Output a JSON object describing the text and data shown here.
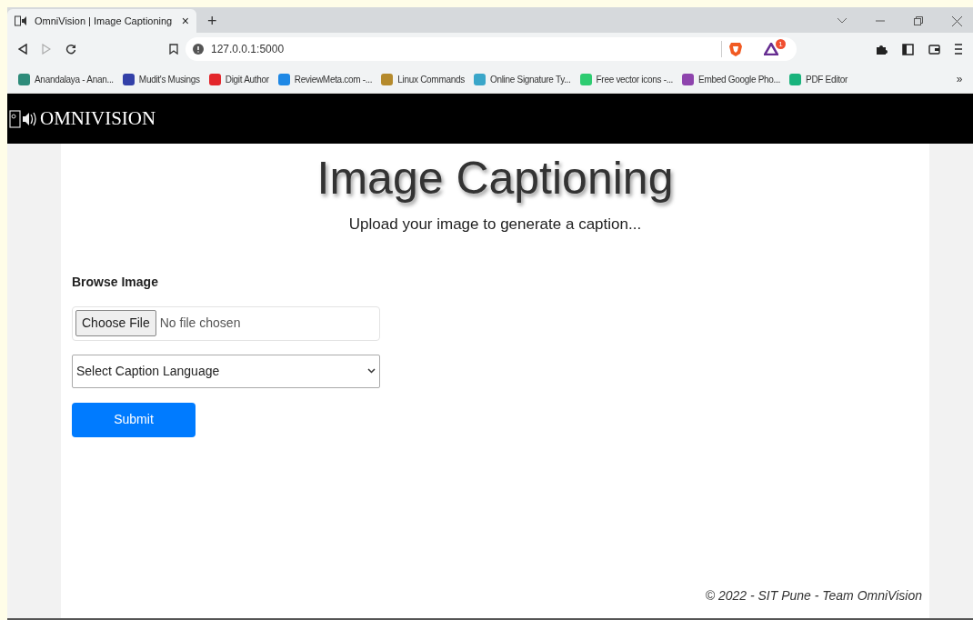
{
  "browser": {
    "tab": {
      "title": "OmniVision | Image Captioning",
      "close": "×",
      "new_tab": "+"
    },
    "url": "127.0.0.1:5000",
    "rewards_badge": "1",
    "bookmarks": [
      {
        "label": "Anandalaya - Anan...",
        "color": "#2e8b7a"
      },
      {
        "label": "Mudit's Musings",
        "color": "#3340a8"
      },
      {
        "label": "Digit Author",
        "color": "#e3262b"
      },
      {
        "label": "ReviewMeta.com -...",
        "color": "#1e88e5"
      },
      {
        "label": "Linux Commands",
        "color": "#b58a2c"
      },
      {
        "label": "Online Signature Ty...",
        "color": "#3aa6c9"
      },
      {
        "label": "Free vector icons -...",
        "color": "#2ecc71"
      },
      {
        "label": "Embed Google Pho...",
        "color": "#8e44ad"
      },
      {
        "label": "PDF Editor",
        "color": "#19b37c"
      }
    ],
    "more": "»"
  },
  "navbar": {
    "brand": "OMNIVISION"
  },
  "page": {
    "heading": "Image Captioning",
    "subtitle": "Upload your image to generate a caption...",
    "form": {
      "label": "Browse Image",
      "file_button": "Choose File",
      "file_status": "No file chosen",
      "language_placeholder": "Select Caption Language",
      "submit": "Submit"
    },
    "footer": "© 2022 - SIT Pune - Team OmniVision"
  }
}
